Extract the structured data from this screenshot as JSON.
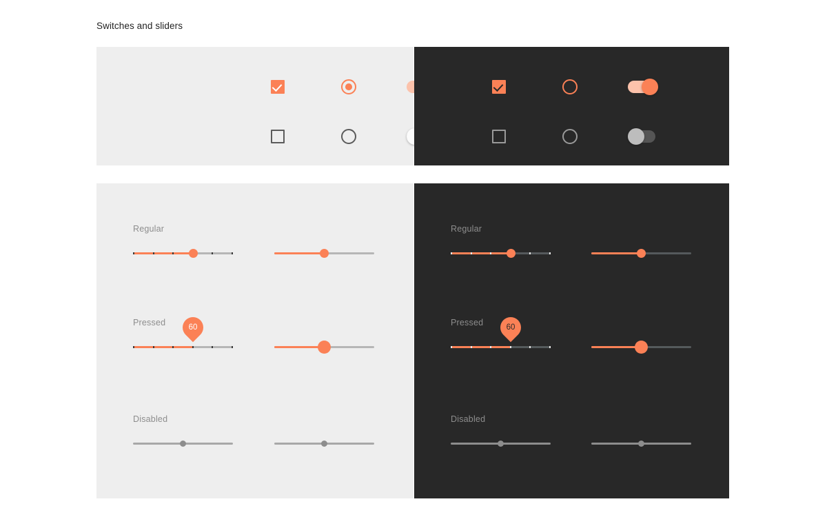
{
  "page": {
    "title": "Switches and sliders",
    "background": "#ffffff"
  },
  "colors": {
    "accent": "#fb8156",
    "accent_light": "#fcc2ab",
    "light_panel_bg": "#eeeeee",
    "dark_panel_bg": "#282828",
    "inactive_track_light": "#b6b6b6",
    "inactive_track_dark": "#555a5c",
    "disabled": "#8d8d8d",
    "label_text": "#8d8d8d",
    "title_text": "#222222"
  },
  "controls_panel": {
    "light": {
      "theme": "light",
      "checkbox_checked": {
        "name": "checkbox-checked",
        "state": "checked"
      },
      "radio_selected": {
        "name": "radio-selected",
        "state": "selected"
      },
      "switch_on": {
        "name": "switch-on",
        "state": "on"
      },
      "checkbox_unchecked": {
        "name": "checkbox-unchecked",
        "state": "unchecked"
      },
      "radio_unselected": {
        "name": "radio-unselected",
        "state": "unselected"
      },
      "switch_off": {
        "name": "switch-off",
        "state": "off"
      }
    },
    "dark": {
      "theme": "dark",
      "checkbox_checked": {
        "name": "checkbox-checked",
        "state": "checked"
      },
      "radio_selected": {
        "name": "radio-selected",
        "state": "selected"
      },
      "switch_on": {
        "name": "switch-on",
        "state": "on"
      },
      "checkbox_unchecked": {
        "name": "checkbox-unchecked",
        "state": "unchecked"
      },
      "radio_unselected": {
        "name": "radio-unselected",
        "state": "unselected"
      },
      "switch_off": {
        "name": "switch-off",
        "state": "off"
      }
    }
  },
  "sliders_panel": {
    "light": {
      "theme": "light",
      "groups": [
        {
          "label": "Regular",
          "discrete": {
            "value": 60,
            "percent": 60,
            "ticks": 6,
            "thumb": "small",
            "show_pin": false
          },
          "continuous": {
            "value": 50,
            "percent": 50,
            "ticks": 0,
            "thumb": "small",
            "show_pin": false
          }
        },
        {
          "label": "Pressed",
          "discrete": {
            "value": 60,
            "percent": 60,
            "ticks": 6,
            "thumb": "hidden",
            "show_pin": true,
            "pin_value": "60"
          },
          "continuous": {
            "value": 50,
            "percent": 50,
            "ticks": 0,
            "thumb": "big",
            "show_pin": false
          }
        },
        {
          "label": "Disabled",
          "discrete": {
            "value": 50,
            "percent": 50,
            "ticks": 0,
            "thumb": "tiny",
            "show_pin": false
          },
          "continuous": {
            "value": 50,
            "percent": 50,
            "ticks": 0,
            "thumb": "tiny",
            "show_pin": false
          }
        }
      ]
    },
    "dark": {
      "theme": "dark",
      "groups": [
        {
          "label": "Regular",
          "discrete": {
            "value": 60,
            "percent": 60,
            "ticks": 6,
            "thumb": "small",
            "show_pin": false
          },
          "continuous": {
            "value": 50,
            "percent": 50,
            "ticks": 0,
            "thumb": "small",
            "show_pin": false
          }
        },
        {
          "label": "Pressed",
          "discrete": {
            "value": 60,
            "percent": 60,
            "ticks": 6,
            "thumb": "hidden",
            "show_pin": true,
            "pin_value": "60"
          },
          "continuous": {
            "value": 50,
            "percent": 50,
            "ticks": 0,
            "thumb": "big",
            "show_pin": false
          }
        },
        {
          "label": "Disabled",
          "discrete": {
            "value": 50,
            "percent": 50,
            "ticks": 0,
            "thumb": "tiny",
            "show_pin": false
          },
          "continuous": {
            "value": 50,
            "percent": 50,
            "ticks": 0,
            "thumb": "tiny",
            "show_pin": false
          }
        }
      ]
    }
  }
}
